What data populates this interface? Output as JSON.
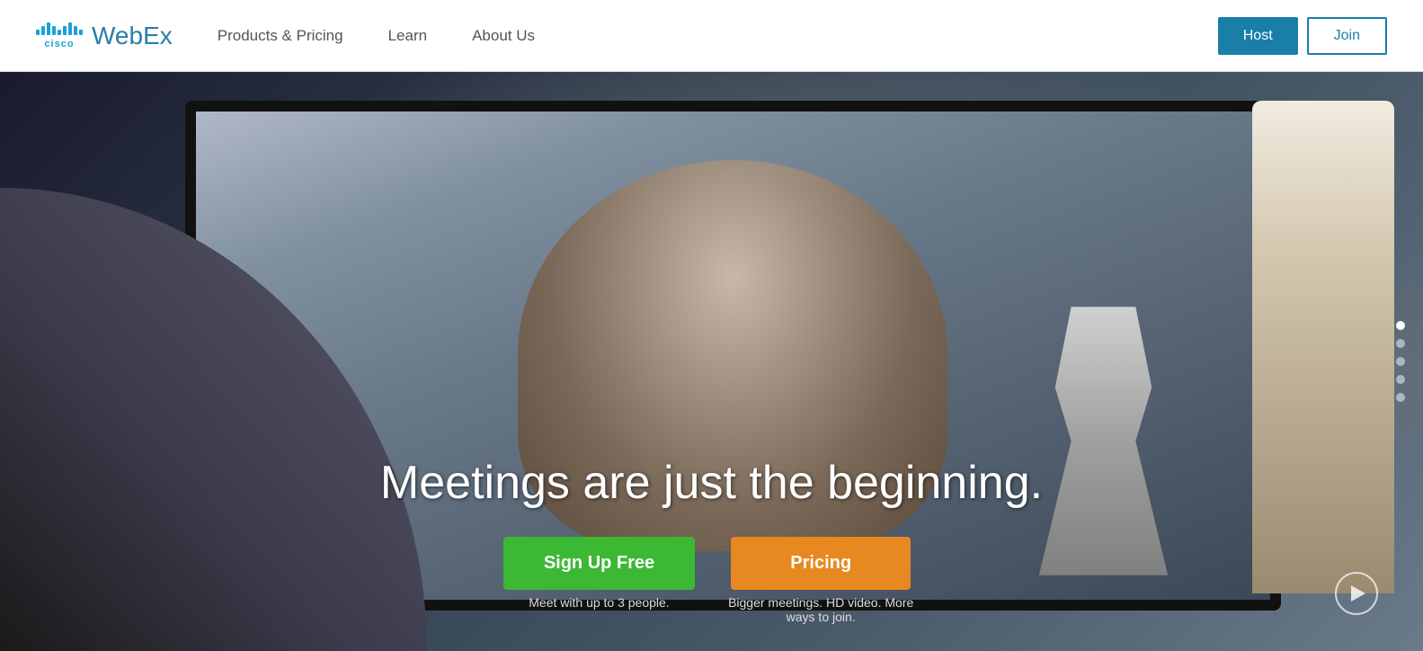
{
  "header": {
    "brand": "WebEx",
    "cisco_label": "cisco",
    "nav": {
      "products_pricing": "Products & Pricing",
      "learn": "Learn",
      "about_us": "About Us"
    },
    "buttons": {
      "host": "Host",
      "join": "Join"
    }
  },
  "hero": {
    "headline": "Meetings are just the beginning.",
    "cta_signup": "Sign Up Free",
    "cta_pricing": "Pricing",
    "subtext_signup": "Meet with up to 3 people.",
    "subtext_pricing": "Bigger meetings. HD video. More ways to join."
  },
  "dots": {
    "count": 5,
    "active_index": 0
  },
  "colors": {
    "teal": "#1a7fa8",
    "green": "#3cb934",
    "orange": "#e88820",
    "white": "#ffffff"
  }
}
